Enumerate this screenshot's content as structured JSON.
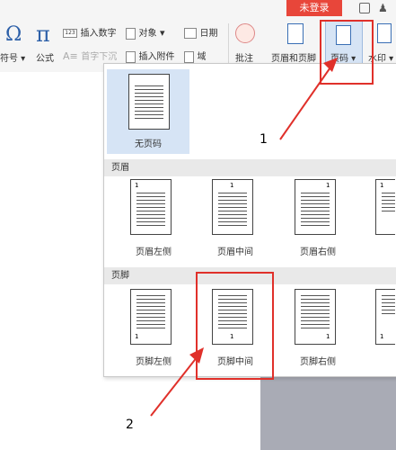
{
  "ribbon": {
    "login_tab": "未登录",
    "symbol_label": "符号",
    "formula_label": "公式",
    "insert_number_label": "插入数字",
    "dropcap_label": "首字下沉",
    "object_label": "对象",
    "attach_label": "插入附件",
    "date_label": "日期",
    "field_label": "域",
    "comment_label": "批注",
    "header_footer_label": "页眉和页脚",
    "page_number_label": "页码",
    "watermark_label": "水印"
  },
  "popup": {
    "none_label": "无页码",
    "header_section": "页眉",
    "footer_section": "页脚",
    "header_options": [
      "页眉左侧",
      "页眉中间",
      "页眉右侧"
    ],
    "footer_options": [
      "页脚左侧",
      "页脚中间",
      "页脚右侧"
    ],
    "page_num_digit": "1"
  },
  "annotations": {
    "step1": "1",
    "step2": "2"
  },
  "colors": {
    "highlight_box": "#e0302a",
    "selected_bg": "#d6e4f5",
    "login_tab": "#e8463a"
  }
}
